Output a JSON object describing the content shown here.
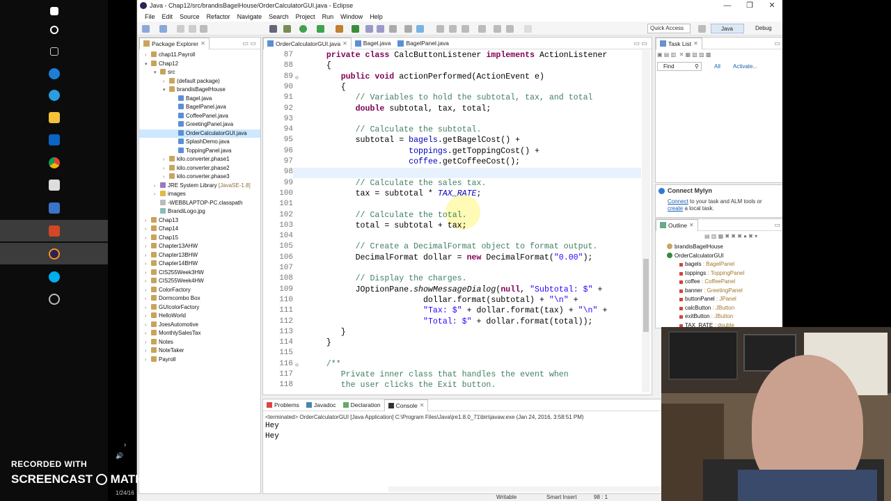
{
  "window": {
    "title": "Java - Chap12/src/brandisBagelHouse/OrderCalculatorGUI.java - Eclipse"
  },
  "menu": [
    "File",
    "Edit",
    "Source",
    "Refactor",
    "Navigate",
    "Search",
    "Project",
    "Run",
    "Window",
    "Help"
  ],
  "toolbar": {
    "quick_access_placeholder": "Quick Access",
    "perspectives": [
      "Java",
      "Debug"
    ]
  },
  "package_explorer": {
    "tab_label": "Package Explorer",
    "items": [
      {
        "label": "chap11.Payroll",
        "depth": 0,
        "expanded": false,
        "icon": "project"
      },
      {
        "label": "Chap12",
        "depth": 0,
        "expanded": true,
        "icon": "project"
      },
      {
        "label": "src",
        "depth": 1,
        "expanded": true,
        "icon": "src-folder"
      },
      {
        "label": "(default package)",
        "depth": 2,
        "expanded": false,
        "icon": "package"
      },
      {
        "label": "brandisBagelHouse",
        "depth": 2,
        "expanded": true,
        "icon": "package"
      },
      {
        "label": "Bagel.java",
        "depth": 3,
        "expanded": false,
        "icon": "java-file"
      },
      {
        "label": "BagelPanel.java",
        "depth": 3,
        "expanded": false,
        "icon": "java-file"
      },
      {
        "label": "CoffeePanel.java",
        "depth": 3,
        "expanded": false,
        "icon": "java-file"
      },
      {
        "label": "GreetingPanel.java",
        "depth": 3,
        "expanded": false,
        "icon": "java-file"
      },
      {
        "label": "OrderCalculatorGUI.java",
        "depth": 3,
        "expanded": false,
        "icon": "java-file",
        "selected": true
      },
      {
        "label": "SplashDemo.java",
        "depth": 3,
        "expanded": false,
        "icon": "java-file"
      },
      {
        "label": "ToppingPanel.java",
        "depth": 3,
        "expanded": false,
        "icon": "java-file"
      },
      {
        "label": "kilo.converter.phase1",
        "depth": 2,
        "expanded": false,
        "icon": "package"
      },
      {
        "label": "kilo.converter.phase2",
        "depth": 2,
        "expanded": false,
        "icon": "package"
      },
      {
        "label": "kilo.converter.phase3",
        "depth": 2,
        "expanded": false,
        "icon": "package"
      },
      {
        "label": "JRE System Library",
        "suffix": "[JavaSE-1.8]",
        "depth": 1,
        "expanded": false,
        "icon": "library"
      },
      {
        "label": "images",
        "depth": 1,
        "expanded": false,
        "icon": "folder"
      },
      {
        "label": "-WEBBLAPTOP-PC.classpath",
        "depth": 1,
        "expanded": false,
        "icon": "file"
      },
      {
        "label": "BrandiLogo.jpg",
        "depth": 1,
        "expanded": false,
        "icon": "image-file"
      },
      {
        "label": "Chap13",
        "depth": 0,
        "expanded": false,
        "icon": "project"
      },
      {
        "label": "Chap14",
        "depth": 0,
        "expanded": false,
        "icon": "project"
      },
      {
        "label": "Chap15",
        "depth": 0,
        "expanded": false,
        "icon": "project"
      },
      {
        "label": "Chapter13AHW",
        "depth": 0,
        "expanded": false,
        "icon": "project"
      },
      {
        "label": "Chapter13BHW",
        "depth": 0,
        "expanded": false,
        "icon": "project"
      },
      {
        "label": "Chapter14BHW",
        "depth": 0,
        "expanded": false,
        "icon": "project"
      },
      {
        "label": "CIS255Week3HW",
        "depth": 0,
        "expanded": false,
        "icon": "project"
      },
      {
        "label": "CIS255Week4HW",
        "depth": 0,
        "expanded": false,
        "icon": "project"
      },
      {
        "label": "ColorFactory",
        "depth": 0,
        "expanded": false,
        "icon": "project"
      },
      {
        "label": "Dormcombo Box",
        "depth": 0,
        "expanded": false,
        "icon": "project"
      },
      {
        "label": "GUIcolorFactory",
        "depth": 0,
        "expanded": false,
        "icon": "project"
      },
      {
        "label": "HelloWorld",
        "depth": 0,
        "expanded": false,
        "icon": "project"
      },
      {
        "label": "JoesAutomotive",
        "depth": 0,
        "expanded": false,
        "icon": "project"
      },
      {
        "label": "MonthlySalesTax",
        "depth": 0,
        "expanded": false,
        "icon": "project"
      },
      {
        "label": "Notes",
        "depth": 0,
        "expanded": false,
        "icon": "project"
      },
      {
        "label": "NoteTaker",
        "depth": 0,
        "expanded": false,
        "icon": "project"
      },
      {
        "label": "Payroll",
        "depth": 0,
        "expanded": false,
        "icon": "project"
      }
    ]
  },
  "editor": {
    "tabs": [
      {
        "label": "OrderCalculatorGUI.java",
        "active": true
      },
      {
        "label": "Bagel.java",
        "active": false
      },
      {
        "label": "BagelPanel.java",
        "active": false
      }
    ],
    "lines": [
      {
        "n": "87",
        "html": "    <span class='kw'>private class</span> CalcButtonListener <span class='kw'>implements</span> ActionListener"
      },
      {
        "n": "88",
        "html": "    {"
      },
      {
        "n": "89",
        "html": "       <span class='kw'>public void</span> actionPerformed(ActionEvent e)"
      },
      {
        "n": "90",
        "html": "       {"
      },
      {
        "n": "91",
        "html": "          <span class='cm'>// Variables to hold the subtotal, tax, and total</span>"
      },
      {
        "n": "92",
        "html": "          <span class='kw'>double</span> subtotal, tax, total;"
      },
      {
        "n": "93",
        "html": ""
      },
      {
        "n": "94",
        "html": "          <span class='cm'>// Calculate the subtotal.</span>"
      },
      {
        "n": "95",
        "html": "          subtotal = <span class='fld'>bagels</span>.getBagelCost() +"
      },
      {
        "n": "96",
        "html": "                     <span class='fld'>toppings</span>.getToppingCost() +"
      },
      {
        "n": "97",
        "html": "                     <span class='fld'>coffee</span>.getCoffeeCost();"
      },
      {
        "n": "98",
        "html": ""
      },
      {
        "n": "99",
        "html": "          <span class='cm'>// Calculate the sales tax.</span>"
      },
      {
        "n": "100",
        "html": "          tax = subtotal * <span class='fld it'>TAX_RATE</span>;"
      },
      {
        "n": "101",
        "html": ""
      },
      {
        "n": "102",
        "html": "          <span class='cm'>// Calculate the total.</span>"
      },
      {
        "n": "103",
        "html": "          total = subtotal + tax;"
      },
      {
        "n": "104",
        "html": ""
      },
      {
        "n": "105",
        "html": "          <span class='cm'>// Create a DecimalFormat object to format output.</span>"
      },
      {
        "n": "106",
        "html": "          DecimalFormat dollar = <span class='kw'>new</span> DecimalFormat(<span class='st'>\"0.00\"</span>);"
      },
      {
        "n": "107",
        "html": ""
      },
      {
        "n": "108",
        "html": "          <span class='cm'>// Display the charges.</span>"
      },
      {
        "n": "109",
        "html": "          JOptionPane.<span class='it'>showMessageDialog</span>(<span class='kw'>null</span>, <span class='st'>\"Subtotal: $\"</span> +"
      },
      {
        "n": "110",
        "html": "                        dollar.format(subtotal) + <span class='st'>\"\\n\"</span> +"
      },
      {
        "n": "111",
        "html": "                        <span class='st'>\"Tax: $\"</span> + dollar.format(tax) + <span class='st'>\"\\n\"</span> +"
      },
      {
        "n": "112",
        "html": "                        <span class='st'>\"Total: $\"</span> + dollar.format(total));"
      },
      {
        "n": "113",
        "html": "       }"
      },
      {
        "n": "114",
        "html": "    }"
      },
      {
        "n": "115",
        "html": ""
      },
      {
        "n": "116",
        "html": "    <span class='cm'>/**</span>"
      },
      {
        "n": "117",
        "html": "       <span class='cm'>Private inner class that handles the event when</span>"
      },
      {
        "n": "118",
        "html": "       <span class='cm'>the user clicks the Exit button.</span>"
      }
    ]
  },
  "console": {
    "tabs": [
      {
        "label": "Problems",
        "active": false
      },
      {
        "label": "Javadoc",
        "active": false
      },
      {
        "label": "Declaration",
        "active": false
      },
      {
        "label": "Console",
        "active": true
      }
    ],
    "meta": "<terminated> OrderCalculatorGUI [Java Application] C:\\Program Files\\Java\\jre1.8.0_71\\bin\\javaw.exe (Jan 24, 2016, 3:58:51 PM)",
    "output": [
      "Hey",
      "Hey"
    ]
  },
  "task_list": {
    "tab_label": "Task List",
    "find_placeholder": "Find",
    "all_label": "All",
    "activate_label": "Activate..."
  },
  "mylyn": {
    "title": "Connect Mylyn",
    "connect_link": "Connect",
    "text1": " to your task and ALM tools or",
    "create_link": "create",
    "text2": " a local task."
  },
  "outline": {
    "tab_label": "Outline",
    "items": [
      {
        "label": "brandisBagelHouse",
        "type": "",
        "depth": 0,
        "icon": "package"
      },
      {
        "label": "OrderCalculatorGUI",
        "type": "",
        "depth": 0,
        "icon": "class",
        "expanded": true
      },
      {
        "label": "bagels",
        "type": " : BagelPanel",
        "depth": 1,
        "icon": "private-field"
      },
      {
        "label": "toppings",
        "type": " : ToppingPanel",
        "depth": 1,
        "icon": "private-field"
      },
      {
        "label": "coffee",
        "type": " : CoffeePanel",
        "depth": 1,
        "icon": "private-field"
      },
      {
        "label": "banner",
        "type": " : GreetingPanel",
        "depth": 1,
        "icon": "private-field"
      },
      {
        "label": "buttonPanel",
        "type": " : JPanel",
        "depth": 1,
        "icon": "private-field"
      },
      {
        "label": "calcButton",
        "type": " : JButton",
        "depth": 1,
        "icon": "private-field"
      },
      {
        "label": "exitButton",
        "type": " : JButton",
        "depth": 1,
        "icon": "private-field"
      },
      {
        "label": "TAX_RATE",
        "type": " : double",
        "depth": 1,
        "icon": "final-field"
      }
    ]
  },
  "statusbar": {
    "writable": "Writable",
    "insert_mode": "Smart Insert",
    "position": "98 : 1"
  },
  "watermark": {
    "line1": "RECORDED WITH",
    "line2": "SCREENCAST",
    "line3": "MATIC"
  },
  "clock_date": "1/24/16",
  "colors": {
    "keyword": "#7f0055",
    "comment": "#3f7f5f",
    "string": "#2a00ff",
    "field": "#0000c0",
    "selection": "#cde8ff"
  }
}
